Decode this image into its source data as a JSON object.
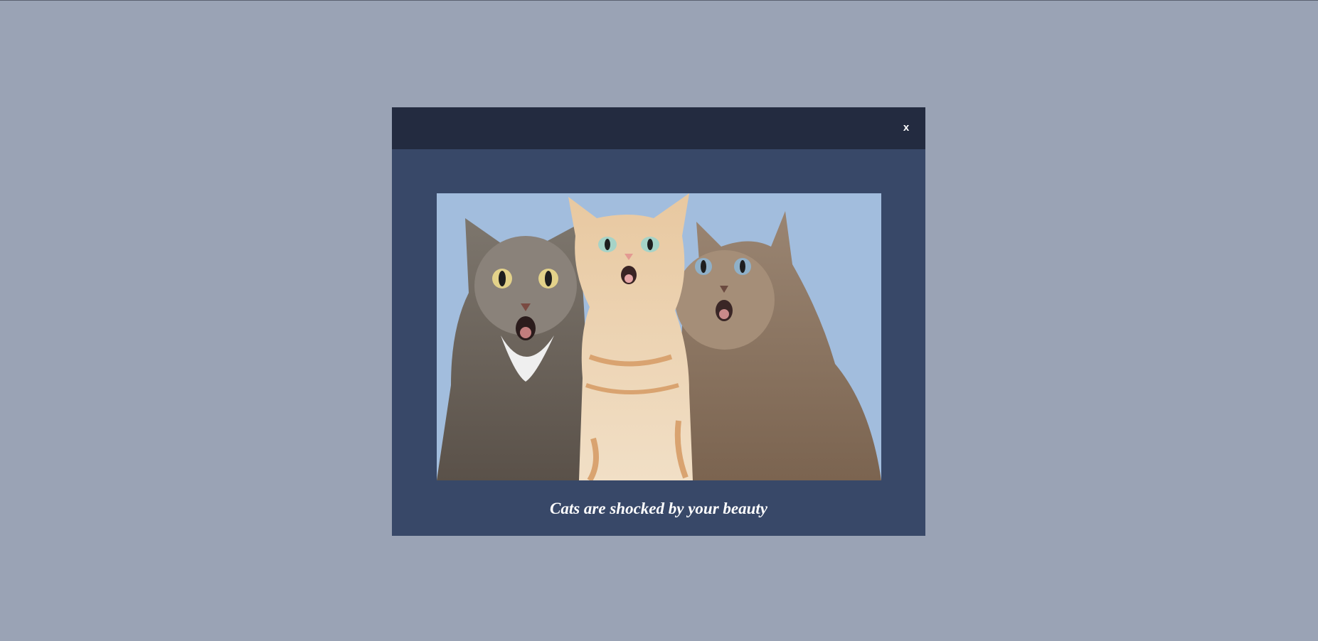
{
  "modal": {
    "close_label": "x",
    "caption": "Cats are shocked by your beauty",
    "image": {
      "subject": "three-shocked-cats-photo",
      "background_color": "#a2bddd"
    }
  },
  "colors": {
    "page_background": "#9aa3b5",
    "modal_header": "#232b40",
    "modal_body": "#384868",
    "text": "#ffffff"
  }
}
